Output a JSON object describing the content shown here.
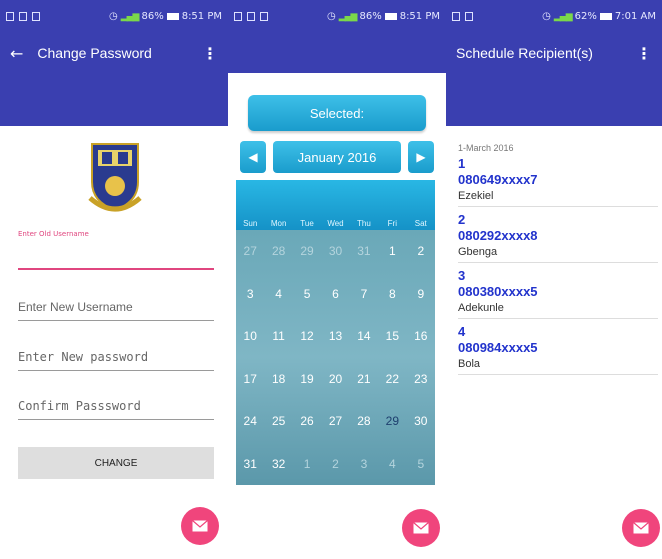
{
  "screens": [
    {
      "status": {
        "battery": "86%",
        "time": "8:51 PM"
      },
      "appbar": {
        "back_icon": "arrow-back-icon",
        "title": "Change Password",
        "menu_icon": "more-vert-icon"
      },
      "form": {
        "old_username_label": "Enter Old Username",
        "new_username_placeholder": "Enter New Username",
        "new_password_placeholder": "Enter New password",
        "confirm_password_placeholder": "Confirm Passsword",
        "change_button": "CHANGE"
      },
      "fab_icon": "mail-icon",
      "colors": {
        "primary": "#3a3fb0",
        "accent": "#f0457c"
      }
    },
    {
      "status": {
        "battery": "86%",
        "time": "8:51 PM"
      },
      "calendar": {
        "selected_label": "Selected:",
        "month": "January 2016",
        "prev_icon": "chevron-left-icon",
        "next_icon": "chevron-right-icon",
        "weekdays": [
          "Sun",
          "Mon",
          "Tue",
          "Wed",
          "Thu",
          "Fri",
          "Sat"
        ],
        "days": [
          {
            "d": "27",
            "dim": true
          },
          {
            "d": "28",
            "dim": true
          },
          {
            "d": "29",
            "dim": true
          },
          {
            "d": "30",
            "dim": true
          },
          {
            "d": "31",
            "dim": true
          },
          {
            "d": "1"
          },
          {
            "d": "2"
          },
          {
            "d": "3"
          },
          {
            "d": "4"
          },
          {
            "d": "5"
          },
          {
            "d": "6"
          },
          {
            "d": "7"
          },
          {
            "d": "8"
          },
          {
            "d": "9"
          },
          {
            "d": "10"
          },
          {
            "d": "11"
          },
          {
            "d": "12"
          },
          {
            "d": "13"
          },
          {
            "d": "14"
          },
          {
            "d": "15"
          },
          {
            "d": "16"
          },
          {
            "d": "17"
          },
          {
            "d": "18"
          },
          {
            "d": "19"
          },
          {
            "d": "20"
          },
          {
            "d": "21"
          },
          {
            "d": "22"
          },
          {
            "d": "23"
          },
          {
            "d": "24"
          },
          {
            "d": "25"
          },
          {
            "d": "26"
          },
          {
            "d": "27"
          },
          {
            "d": "28"
          },
          {
            "d": "29",
            "today": true
          },
          {
            "d": "30"
          },
          {
            "d": "31"
          },
          {
            "d": "32"
          },
          {
            "d": "1",
            "dim": true
          },
          {
            "d": "2",
            "dim": true
          },
          {
            "d": "3",
            "dim": true
          },
          {
            "d": "4",
            "dim": true
          },
          {
            "d": "5",
            "dim": true
          }
        ]
      },
      "fab_icon": "mail-icon"
    },
    {
      "status": {
        "battery": "62%",
        "time": "7:01 AM"
      },
      "appbar": {
        "title": "Schedule Recipient(s)",
        "menu_icon": "more-vert-icon"
      },
      "date": "1-March 2016",
      "recipients": [
        {
          "index": "1",
          "phone": "080649xxxx7",
          "name": "Ezekiel"
        },
        {
          "index": "2",
          "phone": "080292xxxx8",
          "name": "Gbenga"
        },
        {
          "index": "3",
          "phone": "080380xxxx5",
          "name": "Adekunle"
        },
        {
          "index": "4",
          "phone": "080984xxxx5",
          "name": "Bola"
        }
      ],
      "fab_icon": "mail-icon"
    }
  ]
}
